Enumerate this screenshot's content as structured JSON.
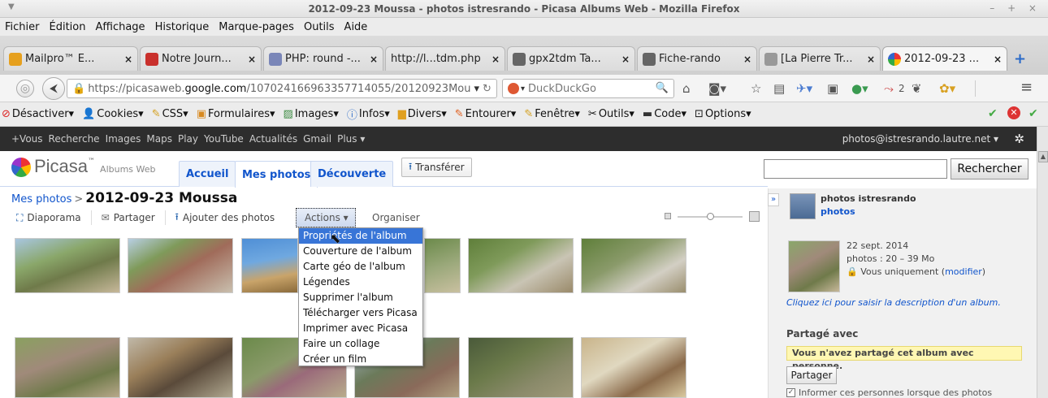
{
  "window": {
    "title": "2012-09-23 Moussa - photos istresrando - Picasa Albums Web - Mozilla Firefox",
    "controls": "– + ×"
  },
  "menubar": [
    "Fichier",
    "Édition",
    "Affichage",
    "Historique",
    "Marque-pages",
    "Outils",
    "Aide"
  ],
  "tabs": [
    {
      "label": "Mailpro™ E...",
      "icon_color": "#e6a01e"
    },
    {
      "label": "Notre Journ...",
      "icon_color": "#c9302c"
    },
    {
      "label": "PHP: round -...",
      "icon_color": "#7a86b8"
    },
    {
      "label": "http://l...tdm.php",
      "icon_color": ""
    },
    {
      "label": "gpx2tdm Ta...",
      "icon_color": "#666"
    },
    {
      "label": "Fiche-rando",
      "icon_color": "#666"
    },
    {
      "label": "[La Pierre Tr...",
      "icon_color": "#999"
    },
    {
      "label": "2012-09-23 ...",
      "icon_color": "#3aa14a"
    }
  ],
  "tab_close": "×",
  "new_tab": "+",
  "nav": {
    "url_prefix": "https://picasaweb.",
    "url_domain": "google.com",
    "url_path": "/107024166963357714055/20120923Mou",
    "search_engine": "DuckDuckGo",
    "badge_count": "2"
  },
  "bookmarks": [
    {
      "label": "Désactiver▾",
      "icon": "no-entry-icon"
    },
    {
      "label": "Cookies▾",
      "icon": "person-icon"
    },
    {
      "label": "CSS▾",
      "icon": "pencil-icon"
    },
    {
      "label": "Formulaires▾",
      "icon": "form-icon"
    },
    {
      "label": "Images▾",
      "icon": "image-icon"
    },
    {
      "label": "Infos▾",
      "icon": "info-icon"
    },
    {
      "label": "Divers▾",
      "icon": "folder-icon"
    },
    {
      "label": "Entourer▾",
      "icon": "pencil-icon"
    },
    {
      "label": "Fenêtre▾",
      "icon": "pencil-icon"
    },
    {
      "label": "Outils▾",
      "icon": "tools-icon"
    },
    {
      "label": "Code▾",
      "icon": "code-icon"
    },
    {
      "label": "Options▾",
      "icon": "options-icon"
    }
  ],
  "googlebar": {
    "links": [
      "+Vous",
      "Recherche",
      "Images",
      "Maps",
      "Play",
      "YouTube",
      "Actualités",
      "Gmail",
      "Plus ▾"
    ],
    "account": "photos@istresrando.lautre.net ▾"
  },
  "picasa": {
    "logo": "Picasa",
    "tm": "™",
    "subtitle": "Albums Web",
    "tabs": [
      "Accueil",
      "Mes photos",
      "Découverte"
    ],
    "upload": "Transférer",
    "search_button": "Rechercher"
  },
  "album": {
    "breadcrumb_link": "Mes photos",
    "breadcrumb_sep": ">",
    "title": "2012-09-23 Moussa",
    "actions": [
      "Diaporama",
      "Partager",
      "Ajouter des photos"
    ],
    "actions_button": "Actions ▾",
    "organiser": "Organiser"
  },
  "dropdown": [
    "Propriétés de l'album",
    "Couverture de l'album",
    "Carte géo de l'album",
    "Légendes",
    "Supprimer l'album",
    "Télécharger vers Picasa",
    "Imprimer avec Picasa",
    "Faire un collage",
    "Créer un film"
  ],
  "side": {
    "expand": "»",
    "owner": "photos istresrando",
    "owner_link": "photos",
    "date": "22 sept. 2014",
    "info": "photos : 20 – 39 Mo",
    "visibility": "Vous uniquement",
    "modify_open": "(",
    "modify": "modifier",
    "modify_close": ")",
    "description_link": "Cliquez ici pour saisir la description d'un album.",
    "shared_title": "Partagé avec",
    "shared_notice": "Vous n'avez partagé cet album avec personne.",
    "share_button": "Partager",
    "notify": "Informer ces personnes lorsque des photos"
  }
}
